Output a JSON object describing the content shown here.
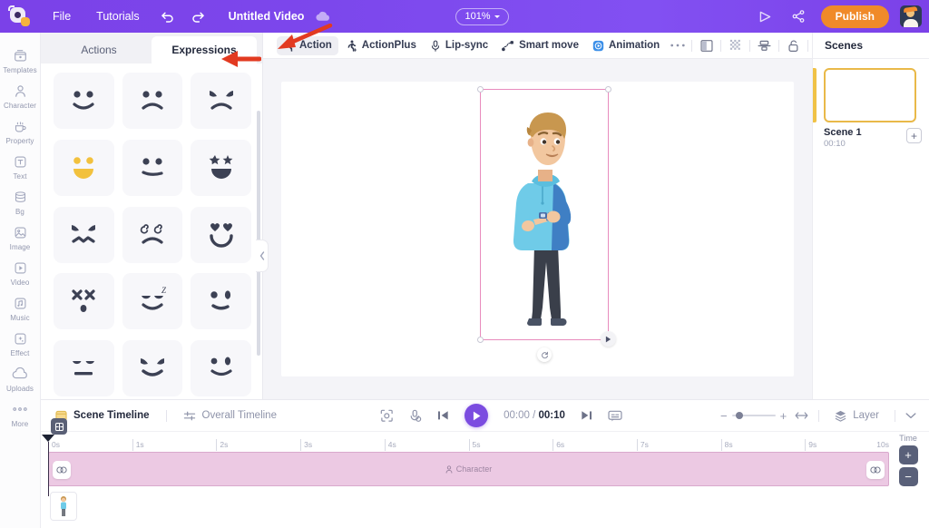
{
  "topbar": {
    "logo": "animaker-logo-icon",
    "menu": [
      {
        "label": "File",
        "name": "menu-file"
      },
      {
        "label": "Tutorials",
        "name": "menu-tutorials"
      }
    ],
    "undo_icon": "undo-icon",
    "redo_icon": "redo-icon",
    "project_title": "Untitled Video",
    "cloud_icon": "cloud-save-icon",
    "zoom_level": "101%",
    "preview_icon": "preview-play-icon",
    "share_icon": "share-icon",
    "publish_label": "Publish",
    "avatar": "user-avatar"
  },
  "rail": {
    "items": [
      {
        "label": "Templates",
        "icon": "templates-icon"
      },
      {
        "label": "Character",
        "icon": "character-icon"
      },
      {
        "label": "Property",
        "icon": "property-icon"
      },
      {
        "label": "Text",
        "icon": "text-icon"
      },
      {
        "label": "Bg",
        "icon": "background-icon"
      },
      {
        "label": "Image",
        "icon": "image-icon"
      },
      {
        "label": "Video",
        "icon": "video-icon"
      },
      {
        "label": "Music",
        "icon": "music-icon"
      },
      {
        "label": "Effect",
        "icon": "effect-icon"
      },
      {
        "label": "Uploads",
        "icon": "uploads-icon"
      },
      {
        "label": "More",
        "icon": "more-icon"
      }
    ]
  },
  "library": {
    "tabs": [
      {
        "label": "Actions",
        "active": false
      },
      {
        "label": "Expressions",
        "active": true
      }
    ],
    "expressions": [
      {
        "name": "smile"
      },
      {
        "name": "sad"
      },
      {
        "name": "angry"
      },
      {
        "name": "happy-yellow"
      },
      {
        "name": "confused"
      },
      {
        "name": "star-struck"
      },
      {
        "name": "furious"
      },
      {
        "name": "dizzy"
      },
      {
        "name": "in-love"
      },
      {
        "name": "dead"
      },
      {
        "name": "sleepy"
      },
      {
        "name": "wink"
      },
      {
        "name": "neutral-closed"
      },
      {
        "name": "evil-grin"
      },
      {
        "name": "wink-smile"
      }
    ],
    "collapse_icon": "chevron-left-icon"
  },
  "stage": {
    "thumbnail": "scene-thumbnail",
    "buttons": [
      {
        "label": "Action",
        "icon": "running-person-icon",
        "active": true
      },
      {
        "label": "ActionPlus",
        "icon": "running-person-plus-icon",
        "active": false
      },
      {
        "label": "Lip-sync",
        "icon": "microphone-icon",
        "active": false
      },
      {
        "label": "Smart move",
        "icon": "smart-move-icon",
        "active": false
      },
      {
        "label": "Animation",
        "icon": "animation-icon",
        "active": false
      }
    ],
    "tools": [
      {
        "icon": "more-options-icon",
        "name": "more-options-icon"
      },
      {
        "icon": "flip-icon",
        "name": "flip-icon"
      },
      {
        "icon": "transparency-icon",
        "name": "transparency-icon"
      },
      {
        "icon": "align-icon",
        "name": "align-icon"
      },
      {
        "icon": "lock-icon",
        "name": "lock-icon"
      },
      {
        "icon": "trash-icon",
        "name": "trash-icon"
      }
    ],
    "selection": {
      "rotate_icon": "rotate-icon",
      "play_icon": "play-preview-icon"
    },
    "character_alt": "male-character-pointing-at-watch"
  },
  "scenes": {
    "title": "Scenes",
    "items": [
      {
        "name": "Scene 1",
        "duration": "00:10"
      }
    ],
    "add_label": "+"
  },
  "timeline": {
    "tabs": [
      {
        "label": "Scene Timeline",
        "icon": "scene-timeline-icon",
        "active": true
      },
      {
        "label": "Overall Timeline",
        "icon": "overall-timeline-icon",
        "active": false
      }
    ],
    "controls": {
      "focus_icon": "focus-icon",
      "mic_icon": "record-voice-icon",
      "prev_icon": "skip-previous-icon",
      "play_icon": "play-icon",
      "next_icon": "skip-next-icon",
      "subtitle_icon": "subtitle-icon",
      "current_time": "00:00",
      "separator": "/",
      "total_time": "00:10"
    },
    "right": {
      "zoom_out": "−",
      "zoom_in": "+",
      "fit_icon": "fit-width-icon",
      "layer_label": "Layer",
      "layer_icon": "layer-icon",
      "chevron_icon": "chevron-down-icon"
    },
    "ruler": {
      "ticks": [
        "0s",
        "1s",
        "2s",
        "3s",
        "4s",
        "5s",
        "6s",
        "7s",
        "8s",
        "9s",
        "10s"
      ]
    },
    "lock_icon": "timeline-lock-icon",
    "track": {
      "label": "Character",
      "label_icon": "person-icon",
      "handle_icon": "trim-handle-icon"
    },
    "layer_thumb": "character-layer-thumbnail",
    "time_column": {
      "label": "Time",
      "plus": "+",
      "minus": "−"
    }
  },
  "colors": {
    "brand_purple": "#7b41e8",
    "publish_orange": "#f08a29",
    "scene_accent": "#e9b949",
    "track_pink": "#ecc9e3",
    "selection_pink": "#e88bbd",
    "annotation_red": "#e23a21"
  }
}
